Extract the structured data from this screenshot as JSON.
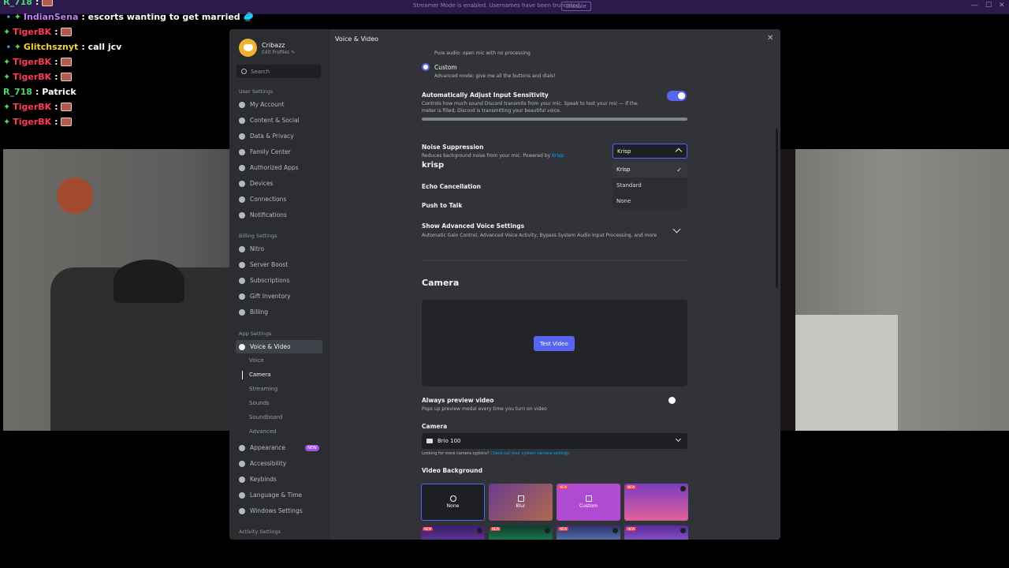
{
  "stream": {
    "notice": "Streamer Mode is enabled. Usernames have been truncated.",
    "disable_label": "Disable",
    "window_controls": [
      "—",
      "☐",
      "✕"
    ]
  },
  "chat": [
    {
      "user": "R_718",
      "color": "#51d66b",
      "badge": "",
      "sep": ":",
      "msg": "",
      "emote": true
    },
    {
      "user": "IndianSena",
      "color": "#c77dff",
      "badge": "🔹✦",
      "sep": ":",
      "msg": "escorts wanting to get married 🥏",
      "emote": false
    },
    {
      "user": "TigerBK",
      "color": "#ff3a58",
      "badge": "✦",
      "sep": ":",
      "msg": "",
      "emote": true
    },
    {
      "user": "Glitchsznyt",
      "color": "#f5d33a",
      "badge": "🔹✦",
      "sep": ":",
      "msg": "call jcv",
      "emote": false
    },
    {
      "user": "TigerBK",
      "color": "#ff3a58",
      "badge": "✦",
      "sep": ":",
      "msg": "",
      "emote": true
    },
    {
      "user": "TigerBK",
      "color": "#ff3a58",
      "badge": "✦",
      "sep": ":",
      "msg": "",
      "emote": true
    },
    {
      "user": "R_718",
      "color": "#51d66b",
      "badge": "",
      "sep": ":",
      "msg": "Patrick",
      "emote": false
    },
    {
      "user": "TigerBK",
      "color": "#ff3a58",
      "badge": "✦",
      "sep": ":",
      "msg": "",
      "emote": true
    },
    {
      "user": "TigerBK",
      "color": "#ff3a58",
      "badge": "✦",
      "sep": ":",
      "msg": "",
      "emote": true
    }
  ],
  "profile": {
    "name": "Cribazz",
    "edit": "Edit Profiles ✎"
  },
  "search": {
    "placeholder": "Search"
  },
  "sidebar": {
    "user_settings": "User Settings",
    "user_items": [
      "My Account",
      "Content & Social",
      "Data & Privacy",
      "Family Center",
      "Authorized Apps",
      "Devices",
      "Connections",
      "Notifications"
    ],
    "billing_settings": "Billing Settings",
    "billing_items": [
      "Nitro",
      "Server Boost",
      "Subscriptions",
      "Gift Inventory",
      "Billing"
    ],
    "app_settings": "App Settings",
    "voice_video": "Voice & Video",
    "voice_sub": [
      "Voice",
      "Camera",
      "Streaming",
      "Sounds",
      "Soundboard",
      "Advanced"
    ],
    "app_items": [
      "Appearance",
      "Accessibility",
      "Keybinds",
      "Language & Time",
      "Windows Settings"
    ],
    "new_badge": "NEW",
    "activity_settings": "Activity Settings"
  },
  "content": {
    "page_title": "Voice & Video",
    "pure_audio_desc": "Pure audio: open mic with no processing",
    "custom_label": "Custom",
    "custom_desc": "Advanced mode: give me all the buttons and dials!",
    "auto_sens_label": "Automatically Adjust Input Sensitivity",
    "auto_sens_desc1": "Controls how much sound Discord transmits from your mic. Speak to test your mic — if the",
    "auto_sens_desc2": "meter is filled, Discord is transmitting your beautiful voice.",
    "meter_level": 1.0,
    "noise_label": "Noise Suppression",
    "noise_desc": "Reduces background noise from your mic. Powered by",
    "noise_link": "Krisp.",
    "krisp_logo": "krisp",
    "noise_selected": "Krisp",
    "noise_options": [
      "Krisp",
      "Standard",
      "None"
    ],
    "echo_label": "Echo Cancellation",
    "ptt_label": "Push to Talk",
    "advanced_label": "Show Advanced Voice Settings",
    "advanced_desc": "Automatic Gain Control, Advanced Voice Activity, Bypass System Audio Input Processing, and more",
    "camera_title": "Camera",
    "test_video": "Test Video",
    "always_preview_label": "Always preview video",
    "always_preview_desc": "Pops up preview modal every time you turn on video",
    "camera_label": "Camera",
    "camera_value": "Brio 100",
    "camera_help": "Looking for more camera options?",
    "camera_help_link": "Check out your system camera settings.",
    "video_bg_label": "Video Background",
    "bg_tiles": [
      "None",
      "Blur",
      "Custom",
      ""
    ],
    "bg_new_badge": "NEW"
  },
  "colors": {
    "accent": "#5865f2",
    "link": "#00a8fc"
  }
}
